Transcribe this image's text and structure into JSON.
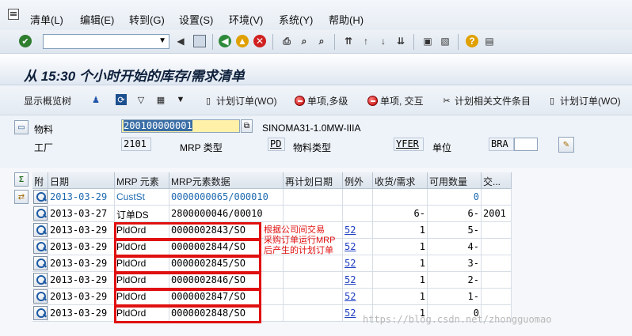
{
  "menu": [
    "清单(L)",
    "编辑(E)",
    "转到(G)",
    "设置(S)",
    "环境(V)",
    "系统(Y)",
    "帮助(H)"
  ],
  "page_title": "从 15:30 个小时开始的库存/需求清单",
  "app_toolbar": {
    "display_overview_tree": "显示概览树",
    "planned_order": "计划订单(WO)",
    "single_item_multilevel": "单项,多级",
    "single_item_cross": "单项, 交互",
    "plan_related_file_item": "计划相关文件条目",
    "planned_order_2": "计划订单(WO)"
  },
  "header": {
    "material_label": "物料",
    "material_value": "200100000001",
    "material_desc": "SINOMA31-1.0MW-IIIA",
    "plant_label": "工厂",
    "plant_value": "2101",
    "mrp_type_label": "MRP 类型",
    "mrp_type_value": "PD",
    "material_type_label": "物料类型",
    "material_type_value": "YFER",
    "unit_label": "单位",
    "unit_value": "BRA"
  },
  "grid": {
    "headers": [
      "附",
      "日期",
      "MRP 元素",
      "MRP元素数据",
      "再计划日期",
      "例外",
      "收货/需求",
      "可用数量",
      "交..."
    ],
    "rows": [
      {
        "date": "2013-03-29",
        "elem": "CustSt",
        "data": "0000000065/000010",
        "replan": "",
        "exc": "",
        "qty": "",
        "avail": "0",
        "del": "",
        "blue": true
      },
      {
        "date": "2013-03-27",
        "elem": "订单DS",
        "data": "2800000046/00010",
        "replan": "",
        "exc": "",
        "qty": "6-",
        "avail": "6-",
        "del": "2001",
        "blue": false
      },
      {
        "date": "2013-03-29",
        "elem": "PldOrd",
        "data": "0000002843/SO",
        "replan": "",
        "exc": "52",
        "qty": "1",
        "avail": "5-",
        "del": "",
        "blue": false
      },
      {
        "date": "2013-03-29",
        "elem": "PldOrd",
        "data": "0000002844/SO",
        "replan": "",
        "exc": "52",
        "qty": "1",
        "avail": "4-",
        "del": "",
        "blue": false
      },
      {
        "date": "2013-03-29",
        "elem": "PldOrd",
        "data": "0000002845/SO",
        "replan": "",
        "exc": "52",
        "qty": "1",
        "avail": "3-",
        "del": "",
        "blue": false
      },
      {
        "date": "2013-03-29",
        "elem": "PldOrd",
        "data": "0000002846/SO",
        "replan": "",
        "exc": "52",
        "qty": "1",
        "avail": "2-",
        "del": "",
        "blue": false
      },
      {
        "date": "2013-03-29",
        "elem": "PldOrd",
        "data": "0000002847/SO",
        "replan": "",
        "exc": "52",
        "qty": "1",
        "avail": "1-",
        "del": "",
        "blue": false
      },
      {
        "date": "2013-03-29",
        "elem": "PldOrd",
        "data": "0000002848/SO",
        "replan": "",
        "exc": "52",
        "qty": "1",
        "avail": "0",
        "del": "",
        "blue": false
      }
    ]
  },
  "annotation": [
    "根据公司间交易",
    "采购订单运行MRP",
    "后产生的计划订单"
  ],
  "watermark": "https://blog.csdn.net/zhongguomao",
  "colors": {
    "annotation": "#e01010",
    "title": "#0d1f3a",
    "link": "#1f3fc1"
  }
}
